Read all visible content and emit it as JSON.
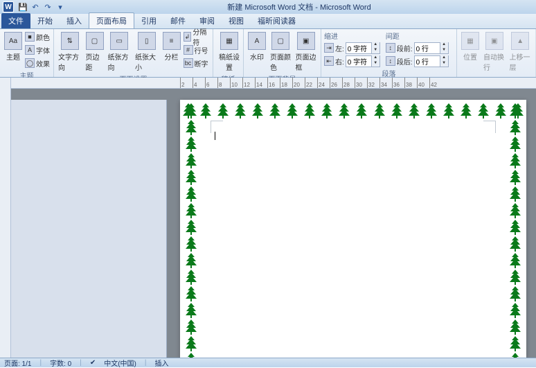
{
  "titlebar": {
    "title": "新建 Microsoft Word 文档 - Microsoft Word",
    "logo": "W"
  },
  "tabs": {
    "file": "文件",
    "items": [
      "开始",
      "插入",
      "页面布局",
      "引用",
      "邮件",
      "审阅",
      "视图",
      "福昕阅读器"
    ],
    "active_index": 2
  },
  "ribbon": {
    "theme": {
      "label": "主题",
      "themes_btn": "主题",
      "colors": "颜色",
      "fonts": "字体",
      "effects": "效果"
    },
    "page_setup": {
      "label": "页面设置",
      "text_direction": "文字方向",
      "margins": "页边距",
      "orientation": "纸张方向",
      "size": "纸张大小",
      "columns": "分栏",
      "breaks": "分隔符",
      "line_numbers": "行号",
      "hyphenation": "断字"
    },
    "manuscript": {
      "label": "稿纸",
      "btn": "稿纸设置"
    },
    "page_bg": {
      "label": "页面背景",
      "watermark": "水印",
      "page_color": "页面颜色",
      "page_borders": "页面边框"
    },
    "paragraph": {
      "label": "段落",
      "indent_title": "缩进",
      "spacing_title": "间距",
      "indent_left_label": "左:",
      "indent_left": "0 字符",
      "indent_right_label": "右:",
      "indent_right": "0 字符",
      "before_label": "段前:",
      "before": "0 行",
      "after_label": "段后:",
      "after": "0 行"
    },
    "arrange": {
      "label": "",
      "position": "位置",
      "wrap": "自动换行",
      "bring_forward": "上移一层"
    }
  },
  "ruler": {
    "start": 2,
    "end": 42,
    "step": 2
  },
  "border_art": {
    "name": "tree",
    "color": "#0a7a1a"
  },
  "statusbar": {
    "page": "页面: 1/1",
    "words": "字数: 0",
    "lang": "中文(中国)",
    "mode": "插入"
  }
}
